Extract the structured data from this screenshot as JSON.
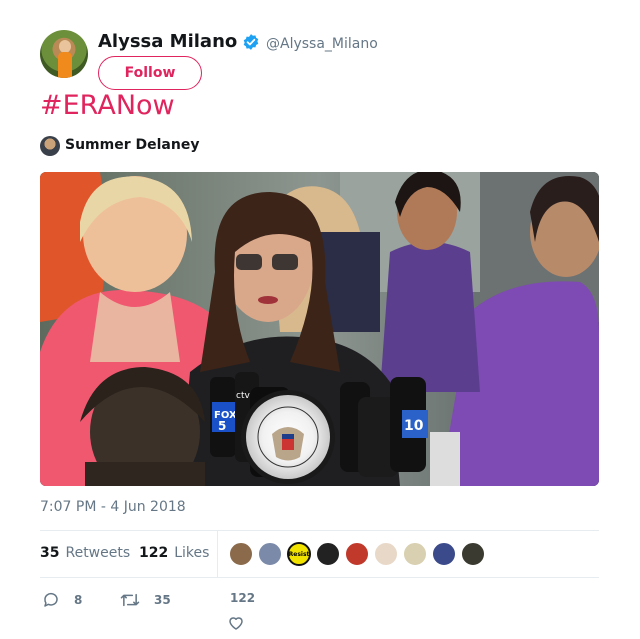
{
  "author": {
    "name": "Alyssa Milano",
    "handle": "@Alyssa_Milano",
    "verified": true
  },
  "follow_button": {
    "label": "Follow"
  },
  "tweet": {
    "text": "#ERANow",
    "tagged_user": "Summer Delaney",
    "timestamp": "7:07 PM - 4 Jun 2018"
  },
  "media": {
    "sign_text": "U.S. HOUSE OF REPRESENTATIVES",
    "mic_labels": [
      "FOX 5",
      "ctv",
      "10"
    ]
  },
  "stats": {
    "retweets_count": "35",
    "retweets_label": "Retweets",
    "likes_count": "122",
    "likes_label": "Likes"
  },
  "likers": [
    {
      "icon": "avatar-1",
      "color": "#8a6a4a"
    },
    {
      "icon": "avatar-2",
      "color": "#7a8aa8"
    },
    {
      "icon": "resist-badge",
      "color": "#f2e200",
      "text": "Resist"
    },
    {
      "icon": "avatar-4",
      "color": "#222222"
    },
    {
      "icon": "avatar-5",
      "color": "#c0392b"
    },
    {
      "icon": "avatar-6",
      "color": "#e8d8c8"
    },
    {
      "icon": "avatar-7",
      "color": "#d8d0b0"
    },
    {
      "icon": "avatar-8",
      "color": "#3b4a8a"
    },
    {
      "icon": "avatar-9",
      "color": "#3a3a30"
    }
  ],
  "actions": {
    "reply_count": "8",
    "retweet_count": "35",
    "like_count": "122"
  },
  "colors": {
    "accent": "#e0245e",
    "verified": "#1da1f2",
    "muted": "#657786"
  }
}
